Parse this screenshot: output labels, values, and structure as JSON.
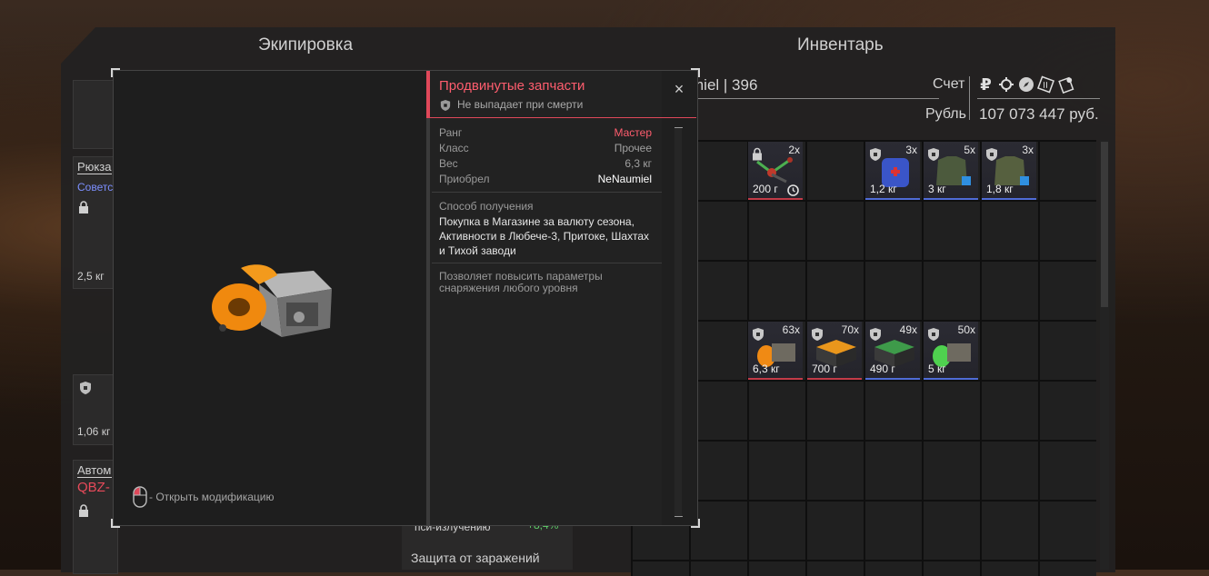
{
  "sections": {
    "equipment_title": "Экипировка",
    "inventory_title": "Инвентарь"
  },
  "equipment": {
    "backpack_label": "Рюкза",
    "backpack_sub": "Советс",
    "backpack_weight": "2,5 кг",
    "slot2_weight": "1,06 кг",
    "weapon_label": "Автом",
    "weapon_name": "QBZ-",
    "psi_label": "пси-излучению",
    "psi_value": "+8,4%",
    "infection_label": "Защита от заражений"
  },
  "inventory_header": {
    "player": "miel | 396",
    "account_label": "Счет",
    "currency_label": "Рубль",
    "balance": "107 073 447 руб.",
    "currency_icons": [
      "ruble-icon",
      "gear-coin-icon",
      "compass-icon",
      "ticket-icon",
      "map-icon"
    ]
  },
  "tooltip": {
    "title": "Продвинутые запчасти",
    "subtitle": "Не выпадает при смерти",
    "close": "×",
    "stats": [
      {
        "label": "Ранг",
        "value": "Мастер",
        "color": "#ff5d6e"
      },
      {
        "label": "Класс",
        "value": "Прочее",
        "color": "#a0a0a0"
      },
      {
        "label": "Вес",
        "value": "6,3 кг",
        "color": "#a0a0a0"
      },
      {
        "label": "Приобрел",
        "value": "NeNaumiel",
        "color": "#ffffff"
      }
    ],
    "acquisition_label": "Способ получения",
    "acquisition_text": "Покупка в Магазине за валюту сезона, Активности в Любече-3, Притоке, Шахтах и Тихой заводи",
    "description": "Позволяет повысить параметры снаряжения любого уровня",
    "hint": "- Открыть модификацию"
  },
  "grid_items": [
    {
      "count": "2x",
      "weight": "200 г",
      "bar": "#c23b48",
      "icon": "lock-icon",
      "art": "sensor",
      "clock": true
    },
    {
      "count": "3x",
      "weight": "1,2 кг",
      "bar": "#4f6cd6",
      "icon": "shield-icon",
      "art": "medkit"
    },
    {
      "count": "5x",
      "weight": "3 кг",
      "bar": "#4f6cd6",
      "icon": "shield-icon",
      "art": "vest"
    },
    {
      "count": "3x",
      "weight": "1,8 кг",
      "bar": "#4f6cd6",
      "icon": "shield-icon",
      "art": "vest"
    },
    {
      "count": "63x",
      "weight": "6,3 кг",
      "bar": "#c23b48",
      "icon": "shield-icon",
      "art": "orange-parts"
    },
    {
      "count": "70x",
      "weight": "700 г",
      "bar": "#c23b48",
      "icon": "shield-icon",
      "art": "orange-box"
    },
    {
      "count": "49x",
      "weight": "490 г",
      "bar": "#4f6cd6",
      "icon": "shield-icon",
      "art": "green-box"
    },
    {
      "count": "50x",
      "weight": "5 кг",
      "bar": "#4f6cd6",
      "icon": "shield-icon",
      "art": "green-parts"
    }
  ]
}
